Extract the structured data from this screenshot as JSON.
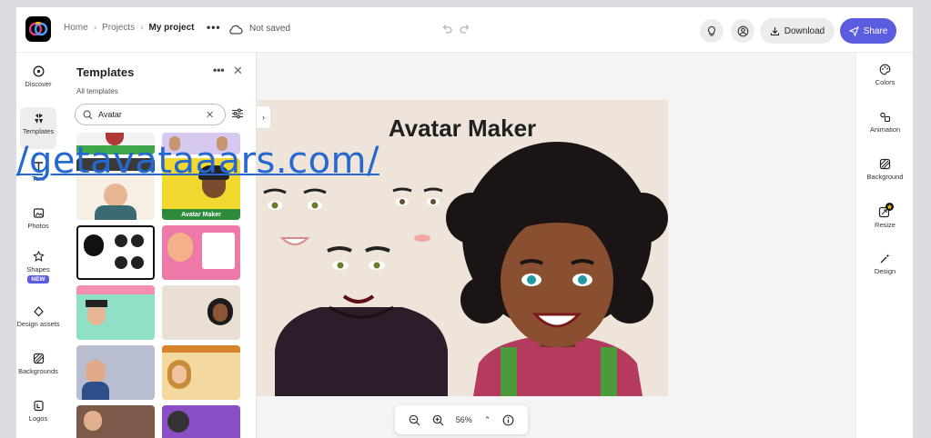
{
  "topbar": {
    "breadcrumbs": [
      "Home",
      "Projects",
      "My project"
    ],
    "more": "•••",
    "save_status": "Not saved",
    "download_label": "Download",
    "share_label": "Share"
  },
  "rail": {
    "items": [
      {
        "label": "Discover",
        "icon": "compass-icon"
      },
      {
        "label": "Templates",
        "icon": "templates-icon"
      },
      {
        "label": "Text",
        "icon": "text-icon"
      },
      {
        "label": "Photos",
        "icon": "photos-icon"
      },
      {
        "label": "Shapes",
        "icon": "shapes-icon",
        "badge": "NEW"
      },
      {
        "label": "Design assets",
        "icon": "design-assets-icon"
      },
      {
        "label": "Backgrounds",
        "icon": "backgrounds-icon"
      },
      {
        "label": "Logos",
        "icon": "logos-icon"
      }
    ]
  },
  "panel": {
    "title": "Templates",
    "subtitle": "All templates",
    "more": "•••",
    "close": "✕",
    "search_value": "Avatar",
    "thumb_caption": "Avatar Maker"
  },
  "canvas": {
    "title": "Avatar Maker",
    "zoom": "56%"
  },
  "right_rail": {
    "items": [
      {
        "label": "Colors",
        "icon": "palette-icon"
      },
      {
        "label": "Animation",
        "icon": "animation-icon"
      },
      {
        "label": "Background",
        "icon": "background-icon"
      },
      {
        "label": "Resize",
        "icon": "resize-icon"
      },
      {
        "label": "Design",
        "icon": "magic-wand-icon"
      }
    ]
  },
  "overlay": {
    "url_text": "/getavataaars.com/"
  },
  "colors": {
    "accent": "#5c5ce0",
    "artboard": "#efe4d9",
    "link": "#2569d0"
  }
}
